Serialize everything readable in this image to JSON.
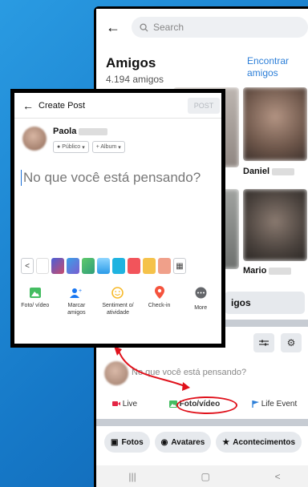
{
  "background_phone": {
    "search_placeholder": "Search",
    "friends_title": "Amigos",
    "friends_count": "4.194 amigos",
    "find_friends": "Encontrar amigos",
    "friend_names": [
      "Daniel",
      "Mario"
    ],
    "friends_button_partial": "igos",
    "post_prompt": "No que você está pensando?",
    "actions": [
      {
        "label": "Live",
        "icon": "live-video-icon"
      },
      {
        "label": "Foto/vídeo",
        "icon": "photo-icon"
      },
      {
        "label": "Life Event",
        "icon": "flag-icon"
      }
    ],
    "chips": [
      {
        "label": "Fotos",
        "icon": "photo-icon"
      },
      {
        "label": "Avatares",
        "icon": "avatar-icon"
      },
      {
        "label": "Acontecimentos",
        "icon": "star-icon"
      }
    ],
    "nav_icons": [
      "recent-apps-icon",
      "home-icon",
      "back-icon"
    ]
  },
  "create_post": {
    "title": "Create Post",
    "post_button": "POST",
    "user_name": "Paola",
    "audience": "Público",
    "album": "+ Album",
    "input_placeholder": "No que você está pensando?",
    "options": [
      {
        "label": "Foto/ vídeo",
        "icon": "photo-icon",
        "color": "#45bd62"
      },
      {
        "label": "Marcar amigos",
        "icon": "tag-friends-icon",
        "color": "#1877f2"
      },
      {
        "label": "Sentiment o/ atividade",
        "icon": "smiley-icon",
        "color": "#f7b928"
      },
      {
        "label": "Check-in",
        "icon": "location-pin-icon",
        "color": "#f5533d"
      },
      {
        "label": "More",
        "icon": "more-icon",
        "color": "#65676b"
      }
    ]
  },
  "colors": {
    "accent_blue": "#2d7fd8",
    "highlight_red": "#e0121c"
  }
}
